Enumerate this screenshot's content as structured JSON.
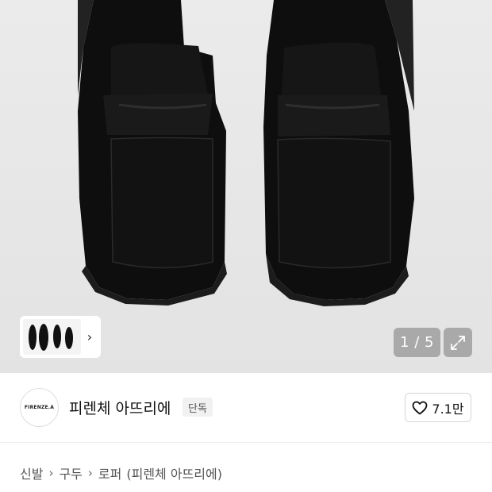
{
  "gallery": {
    "counter_text": "1 / 5",
    "thumbnail_arrow": "›",
    "icons": [
      "chevron-right-icon",
      "expand-icon"
    ]
  },
  "brand": {
    "logo_text": "FIRENZE.A",
    "name": "피렌체 아뜨리에",
    "badge": "단독"
  },
  "like": {
    "count": "7.1만",
    "icon": "heart-icon"
  },
  "breadcrumb": {
    "items": [
      "신발",
      "구두",
      "로퍼",
      "(피렌체 아뜨리에)"
    ],
    "separator": "›"
  },
  "colors": {
    "gallery_bg": "#e6e6e6",
    "overlay_button": "#969696",
    "text": "#111111"
  }
}
